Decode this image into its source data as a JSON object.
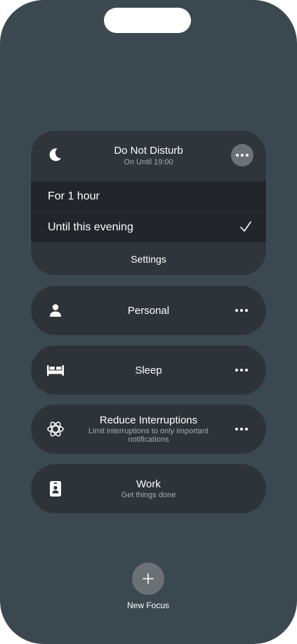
{
  "dnd": {
    "title": "Do Not Disturb",
    "subtitle": "On Until 19:00",
    "icon": "moon-icon",
    "options": [
      {
        "label": "For 1 hour",
        "selected": false
      },
      {
        "label": "Until this evening",
        "selected": true
      }
    ],
    "settings_label": "Settings"
  },
  "focus_modes": [
    {
      "title": "Personal",
      "subtitle": "",
      "icon": "person-icon",
      "has_more": true
    },
    {
      "title": "Sleep",
      "subtitle": "",
      "icon": "bed-icon",
      "has_more": true
    },
    {
      "title": "Reduce Interruptions",
      "subtitle": "Limit interruptions to only important notifications",
      "icon": "atom-icon",
      "has_more": true
    },
    {
      "title": "Work",
      "subtitle": "Get things done",
      "icon": "id-badge-icon",
      "has_more": false
    }
  ],
  "new_focus": {
    "label": "New Focus",
    "icon": "plus-icon"
  },
  "colors": {
    "background": "#3b4850",
    "card": "#2e3339",
    "option_background": "#22262b",
    "more_button": "#6d7178"
  }
}
